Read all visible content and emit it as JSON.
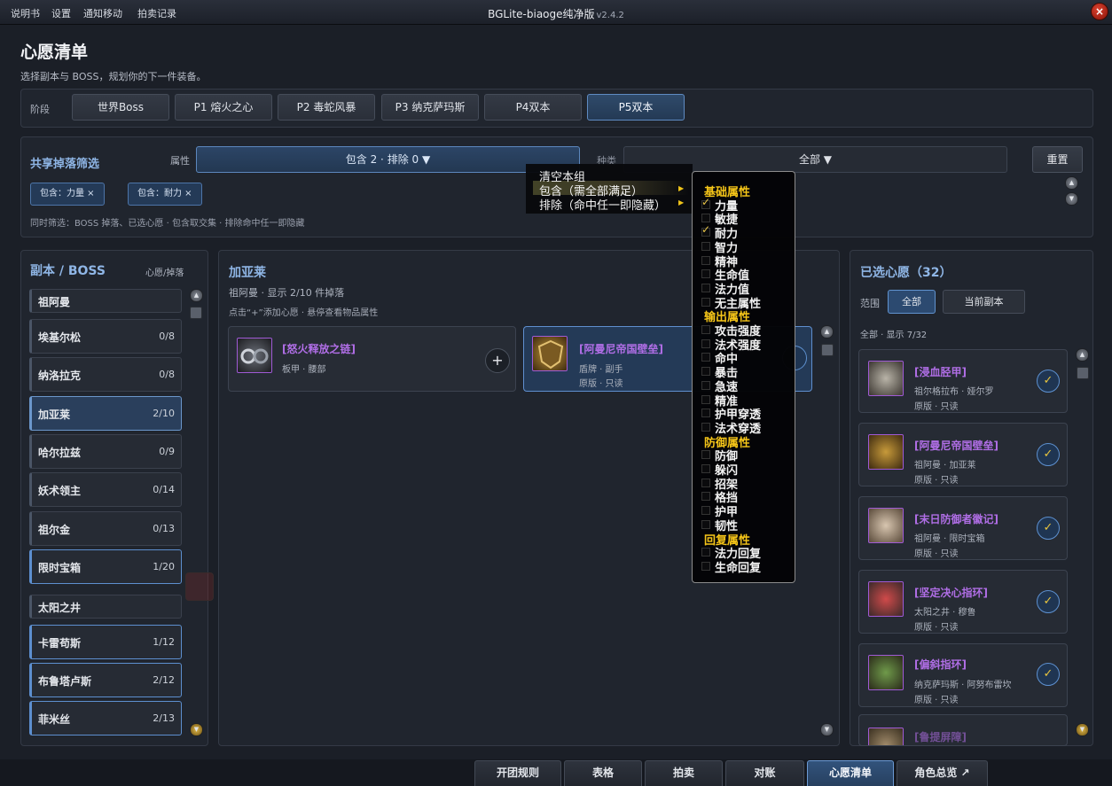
{
  "topbar": {
    "menus": [
      "说明书",
      "设置",
      "通知移动",
      "拍卖记录"
    ],
    "title": "BGLite-biaoge纯净版",
    "version": "v2.4.2",
    "close": "×"
  },
  "page": {
    "title": "心愿清单",
    "subtitle": "选择副本与 BOSS，规划你的下一件装备。"
  },
  "stages": {
    "label": "阶段",
    "items": [
      "世界Boss",
      "P1 熔火之心",
      "P2 毒蛇风暴",
      "P3 纳克萨玛斯",
      "P4双本",
      "P5双本"
    ],
    "active": "P5双本"
  },
  "filter": {
    "title": "共享掉落筛选",
    "attr_label": "属性",
    "attr_value": "包含 2 · 排除 0 ▼",
    "kind_label": "种类",
    "kind_value": "全部 ▼",
    "reset": "重置",
    "chips": [
      "包含：力量 ×",
      "包含：耐力 ×"
    ],
    "note": "同时筛选：BOSS 掉落、已选心愿 · 包含取交集 · 排除命中任一即隐藏"
  },
  "left": {
    "title": "副本 / BOSS",
    "title_right": "心愿/掉落",
    "rows": [
      {
        "name": "祖阿曼",
        "count": ""
      },
      {
        "name": "埃基尔松",
        "count": "0/8"
      },
      {
        "name": "纳洛拉克",
        "count": "0/8"
      },
      {
        "name": "加亚莱",
        "count": "2/10"
      },
      {
        "name": "哈尔拉兹",
        "count": "0/9"
      },
      {
        "name": "妖术领主",
        "count": "0/14"
      },
      {
        "name": "祖尔金",
        "count": "0/13"
      },
      {
        "name": "限时宝箱",
        "count": "1/20"
      },
      {
        "name": "太阳之井",
        "count": ""
      },
      {
        "name": "卡雷苟斯",
        "count": "1/12"
      },
      {
        "name": "布鲁塔卢斯",
        "count": "2/12"
      },
      {
        "name": "菲米丝",
        "count": "2/13"
      }
    ]
  },
  "middle": {
    "title": "加亚莱",
    "line1": "祖阿曼 · 显示 2/10 件掉落",
    "line2": "点击“+”添加心愿 · 悬停查看物品属性",
    "cards": [
      {
        "name": "[怒火释放之链]",
        "meta1": "板甲 · 腰部",
        "meta2": "",
        "add": "+"
      },
      {
        "name": "[阿曼尼帝国壁垒]",
        "meta1": "盾牌 · 副手",
        "meta2": "原版 · 只读",
        "add": ""
      }
    ]
  },
  "right": {
    "title": "已选心愿（32）",
    "scope_label": "范围",
    "scope_all": "全部",
    "scope_current": "当前副本",
    "info": "全部 · 显示 7/32",
    "cards": [
      {
        "name": "[浸血胫甲]",
        "meta1": "祖尔格拉布 · 娅尔罗",
        "meta2": "原版 · 只读"
      },
      {
        "name": "[阿曼尼帝国壁垒]",
        "meta1": "祖阿曼 · 加亚莱",
        "meta2": "原版 · 只读"
      },
      {
        "name": "[末日防御者徽记]",
        "meta1": "祖阿曼 · 限时宝箱",
        "meta2": "原版 · 只读"
      },
      {
        "name": "[坚定决心指环]",
        "meta1": "太阳之井 · 穆鲁",
        "meta2": "原版 · 只读"
      },
      {
        "name": "[偏斜指环]",
        "meta1": "纳克萨玛斯 · 阿努布雷坎",
        "meta2": "原版 · 只读"
      },
      {
        "name": "[鲁提屏障]",
        "meta1": "",
        "meta2": ""
      }
    ]
  },
  "context_menu": {
    "items": [
      "清空本组",
      "包含（需全部满足）",
      "排除（命中任一即隐藏）"
    ]
  },
  "attr_menu": {
    "groups": [
      {
        "title": "基础属性",
        "options": [
          {
            "label": "力量",
            "checked": true
          },
          {
            "label": "敏捷",
            "checked": false
          },
          {
            "label": "耐力",
            "checked": true
          },
          {
            "label": "智力",
            "checked": false
          },
          {
            "label": "精神",
            "checked": false
          },
          {
            "label": "生命值",
            "checked": false
          },
          {
            "label": "法力值",
            "checked": false
          },
          {
            "label": "无主属性",
            "checked": false
          }
        ]
      },
      {
        "title": "输出属性",
        "options": [
          {
            "label": "攻击强度",
            "checked": false
          },
          {
            "label": "法术强度",
            "checked": false
          },
          {
            "label": "命中",
            "checked": false
          },
          {
            "label": "暴击",
            "checked": false
          },
          {
            "label": "急速",
            "checked": false
          },
          {
            "label": "精准",
            "checked": false
          },
          {
            "label": "护甲穿透",
            "checked": false
          },
          {
            "label": "法术穿透",
            "checked": false
          }
        ]
      },
      {
        "title": "防御属性",
        "options": [
          {
            "label": "防御",
            "checked": false
          },
          {
            "label": "躲闪",
            "checked": false
          },
          {
            "label": "招架",
            "checked": false
          },
          {
            "label": "格挡",
            "checked": false
          },
          {
            "label": "护甲",
            "checked": false
          },
          {
            "label": "韧性",
            "checked": false
          }
        ]
      },
      {
        "title": "回复属性",
        "options": [
          {
            "label": "法力回复",
            "checked": false
          },
          {
            "label": "生命回复",
            "checked": false
          }
        ]
      }
    ]
  },
  "bottom_tabs": {
    "items": [
      "开团规则",
      "表格",
      "拍卖",
      "对账",
      "心愿清单",
      "角色总览 ↗"
    ],
    "active": "心愿清单"
  },
  "colors": {
    "accent": "#8fb6e6",
    "epic": "#b06ee6",
    "menu_group": "#f5c518",
    "check": "#e7c43e"
  }
}
